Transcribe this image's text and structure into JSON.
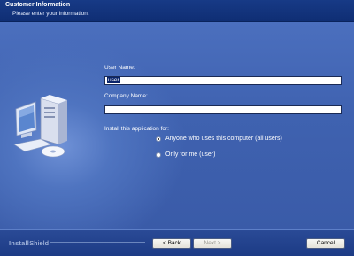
{
  "header": {
    "title": "Customer Information",
    "subtitle": "Please enter your information."
  },
  "form": {
    "user_name_label": "User Name:",
    "user_name_value": "user",
    "company_name_label": "Company Name:",
    "company_name_value": "",
    "install_for_label": "Install this application for:",
    "options": [
      {
        "label": "Anyone who uses this computer (all users)",
        "selected": true
      },
      {
        "label": "Only for me (user)",
        "selected": false
      }
    ]
  },
  "footer": {
    "brand_bold": "Install",
    "brand_light": "Shield",
    "back_label": "< Back",
    "next_label": "Next >",
    "cancel_label": "Cancel"
  },
  "colors": {
    "header_bg": "#173a86",
    "content_bg": "#4b6fbe",
    "selection": "#0a246a"
  }
}
